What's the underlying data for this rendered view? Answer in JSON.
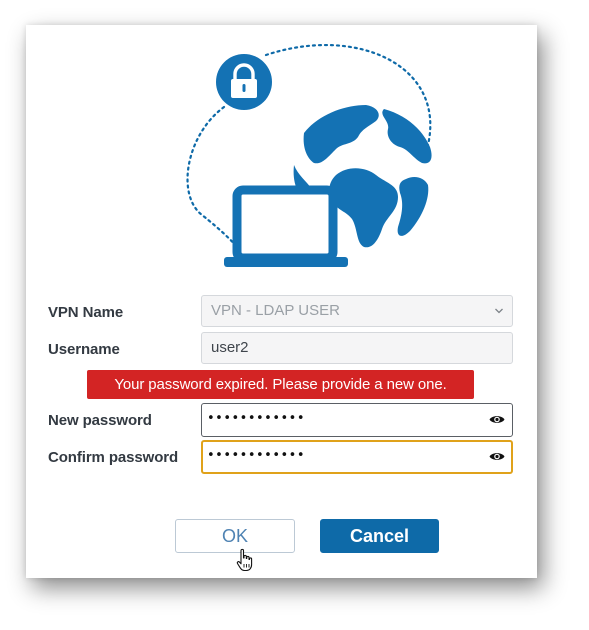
{
  "colors": {
    "brand_blue": "#0e6aa8",
    "error_red": "#d32424",
    "focus_border": "#e0a21a"
  },
  "illustration": {
    "icons": [
      "lock-icon",
      "globe-icon",
      "laptop-icon"
    ]
  },
  "form": {
    "vpn_name_label": "VPN Name",
    "vpn_name_value": "VPN - LDAP USER",
    "username_label": "Username",
    "username_value": "user2",
    "error_message": "Your password expired. Please provide a new one.",
    "new_password_label": "New password",
    "new_password_masked": "••••••••••••",
    "confirm_password_label": "Confirm password",
    "confirm_password_masked": "••••••••••••"
  },
  "buttons": {
    "ok_label": "OK",
    "cancel_label": "Cancel"
  }
}
